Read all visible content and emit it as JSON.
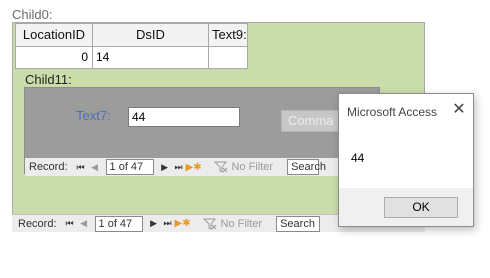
{
  "outer_subform": {
    "label": "Child0:",
    "columns": [
      "LocationID",
      "DsID",
      "Text9:"
    ],
    "row": {
      "location_id": "0",
      "ds_id": "14",
      "text9": ""
    },
    "nav": {
      "record_label": "Record:",
      "position": "1 of 47",
      "filter_label": "No Filter",
      "search_placeholder": "Search"
    }
  },
  "inner_subform": {
    "label": "Child11:",
    "text7_label": "Text7:",
    "text7_value": "44",
    "command_button_label": "Comma",
    "nav": {
      "record_label": "Record:",
      "position": "1 of 47",
      "filter_label": "No Filter",
      "search_placeholder": "Search"
    }
  },
  "dialog": {
    "title": "Microsoft Access",
    "message": "44",
    "ok_label": "OK",
    "close_glyph": "✕"
  },
  "nav_icons": {
    "first": "⏮",
    "prev": "◀",
    "next": "▶",
    "last": "⏭",
    "new": "▶✱"
  },
  "colors": {
    "form_background": "#c9dcaa",
    "subform_background": "#9c9c9c",
    "label_blue": "#4a71b8"
  }
}
